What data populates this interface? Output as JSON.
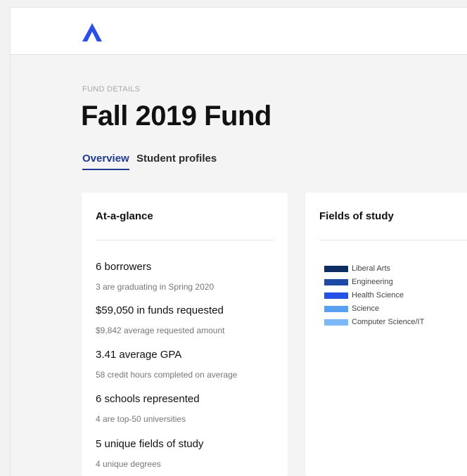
{
  "header": {
    "logo_icon": "chevron-up-logo-icon"
  },
  "page": {
    "eyebrow": "FUND DETAILS",
    "title": "Fall 2019 Fund"
  },
  "tabs": [
    {
      "label": "Overview",
      "active": true
    },
    {
      "label": "Student profiles",
      "active": false
    }
  ],
  "at_a_glance": {
    "title": "At-a-glance",
    "stats": [
      {
        "head": "6 borrowers",
        "sub": "3 are graduating in Spring 2020"
      },
      {
        "head": "$59,050 in funds requested",
        "sub": "$9,842 average requested amount"
      },
      {
        "head": "3.41 average GPA",
        "sub": "58 credit hours completed on average"
      },
      {
        "head": "6 schools represented",
        "sub": "4 are top-50 universities"
      },
      {
        "head": "5 unique fields of study",
        "sub": "4 unique degrees"
      }
    ]
  },
  "fields_of_study": {
    "title": "Fields of study",
    "legend": [
      {
        "label": "Liberal Arts",
        "color": "#0d2d63"
      },
      {
        "label": "Engineering",
        "color": "#1c4aa6"
      },
      {
        "label": "Health Science",
        "color": "#2450e6"
      },
      {
        "label": "Science",
        "color": "#5aa0f2"
      },
      {
        "label": "Computer Science/IT",
        "color": "#7cb8f6"
      }
    ]
  },
  "colors": {
    "accent": "#1f3a93",
    "logo": "#2a4ee8"
  }
}
